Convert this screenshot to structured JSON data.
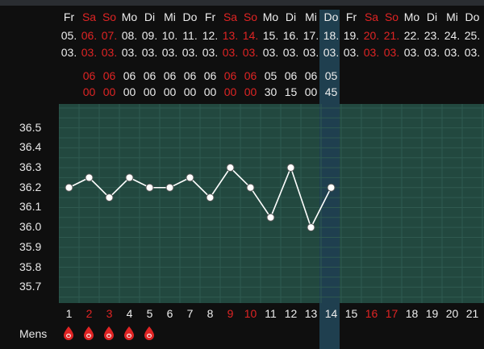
{
  "days": [
    {
      "wd": "Fr",
      "dd": "05.",
      "mm": "03.",
      "hh": "",
      "mi": "",
      "red": false,
      "cycle": "1",
      "mens": true
    },
    {
      "wd": "Sa",
      "dd": "06.",
      "mm": "03.",
      "hh": "06",
      "mi": "00",
      "red": true,
      "cycle": "2",
      "mens": true
    },
    {
      "wd": "So",
      "dd": "07.",
      "mm": "03.",
      "hh": "06",
      "mi": "00",
      "red": true,
      "cycle": "3",
      "mens": true
    },
    {
      "wd": "Mo",
      "dd": "08.",
      "mm": "03.",
      "hh": "06",
      "mi": "00",
      "red": false,
      "cycle": "4",
      "mens": true
    },
    {
      "wd": "Di",
      "dd": "09.",
      "mm": "03.",
      "hh": "06",
      "mi": "00",
      "red": false,
      "cycle": "5",
      "mens": true
    },
    {
      "wd": "Mi",
      "dd": "10.",
      "mm": "03.",
      "hh": "06",
      "mi": "00",
      "red": false,
      "cycle": "6",
      "mens": false
    },
    {
      "wd": "Do",
      "dd": "11.",
      "mm": "03.",
      "hh": "06",
      "mi": "00",
      "red": false,
      "cycle": "7",
      "mens": false
    },
    {
      "wd": "Fr",
      "dd": "12.",
      "mm": "03.",
      "hh": "06",
      "mi": "00",
      "red": false,
      "cycle": "8",
      "mens": false
    },
    {
      "wd": "Sa",
      "dd": "13.",
      "mm": "03.",
      "hh": "06",
      "mi": "00",
      "red": true,
      "cycle": "9",
      "mens": false
    },
    {
      "wd": "So",
      "dd": "14.",
      "mm": "03.",
      "hh": "06",
      "mi": "00",
      "red": true,
      "cycle": "10",
      "mens": false
    },
    {
      "wd": "Mo",
      "dd": "15.",
      "mm": "03.",
      "hh": "05",
      "mi": "30",
      "red": false,
      "cycle": "11",
      "mens": false
    },
    {
      "wd": "Di",
      "dd": "16.",
      "mm": "03.",
      "hh": "06",
      "mi": "15",
      "red": false,
      "cycle": "12",
      "mens": false
    },
    {
      "wd": "Mi",
      "dd": "17.",
      "mm": "03.",
      "hh": "06",
      "mi": "00",
      "red": false,
      "cycle": "13",
      "mens": false
    },
    {
      "wd": "Do",
      "dd": "18.",
      "mm": "03.",
      "hh": "05",
      "mi": "45",
      "red": false,
      "cycle": "14",
      "mens": false
    },
    {
      "wd": "Fr",
      "dd": "19.",
      "mm": "03.",
      "hh": "",
      "mi": "",
      "red": false,
      "cycle": "15",
      "mens": false
    },
    {
      "wd": "Sa",
      "dd": "20.",
      "mm": "03.",
      "hh": "",
      "mi": "",
      "red": true,
      "cycle": "16",
      "mens": false
    },
    {
      "wd": "So",
      "dd": "21.",
      "mm": "03.",
      "hh": "",
      "mi": "",
      "red": true,
      "cycle": "17",
      "mens": false
    },
    {
      "wd": "Mo",
      "dd": "22.",
      "mm": "03.",
      "hh": "",
      "mi": "",
      "red": false,
      "cycle": "18",
      "mens": false
    },
    {
      "wd": "Di",
      "dd": "23.",
      "mm": "03.",
      "hh": "",
      "mi": "",
      "red": false,
      "cycle": "19",
      "mens": false
    },
    {
      "wd": "Mi",
      "dd": "24.",
      "mm": "03.",
      "hh": "",
      "mi": "",
      "red": false,
      "cycle": "20",
      "mens": false
    },
    {
      "wd": "Do",
      "dd": "25.",
      "mm": "03.",
      "hh": "",
      "mi": "",
      "red": false,
      "cycle": "21",
      "mens": false
    },
    {
      "wd": "",
      "dd": "",
      "mm": "03.",
      "hh": "",
      "mi": "",
      "red": false,
      "cycle": "",
      "mens": false
    }
  ],
  "mens_label": "Mens",
  "colors": {
    "plot_bg": "#22483f",
    "highlight": "#1f3f4f",
    "weekend": "#e02424",
    "line": "#ffffff"
  },
  "chart_data": {
    "type": "line",
    "y_ticks": [
      "36.5",
      "36.4",
      "36.3",
      "36.2",
      "36.1",
      "36.0",
      "35.9",
      "35.8",
      "35.7"
    ],
    "ylim": [
      35.62,
      36.62
    ],
    "x": [
      1,
      2,
      3,
      4,
      5,
      6,
      7,
      8,
      9,
      10,
      11,
      12,
      13,
      14
    ],
    "series": [
      {
        "values": [
          36.2,
          36.25,
          36.15,
          36.25,
          36.2,
          36.2,
          36.25,
          36.15,
          36.3,
          36.2,
          36.05,
          36.3,
          36.0,
          36.2
        ]
      }
    ],
    "grid": true,
    "highlight_cycle_day": 14
  }
}
